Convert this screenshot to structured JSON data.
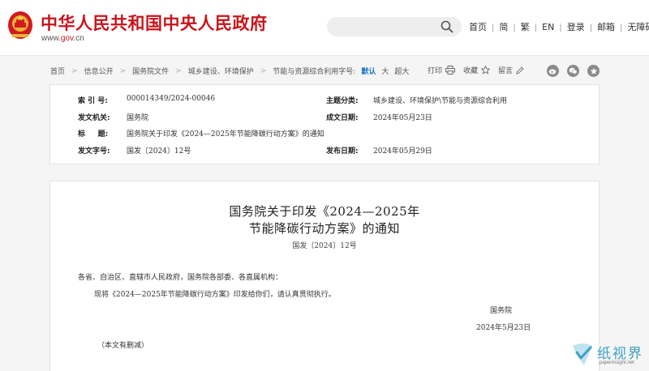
{
  "header": {
    "site_title": "中华人民共和国中央人民政府",
    "url_prefix": "www.",
    "url_brand": "gov",
    "url_suffix": ".cn",
    "search": {
      "value": "",
      "placeholder": ""
    },
    "nav": [
      "首页",
      "简",
      "繁",
      "EN",
      "登录",
      "邮箱",
      "无障碍"
    ]
  },
  "breadcrumb": {
    "items": [
      "首页",
      "信息公开",
      "国务院文件",
      "城乡建设、环境保护",
      "节能与资源综合利用"
    ],
    "font_size_label": "字号:",
    "font_sizes": [
      "默认",
      "大",
      "超大"
    ],
    "active_font_size": "默认"
  },
  "tools": {
    "print": "打印",
    "favorite": "收藏",
    "comment": "留言"
  },
  "share_icons": [
    "weibo-icon",
    "wechat-icon",
    "more-share-icon"
  ],
  "meta": {
    "index_label": "索 引 号:",
    "index_value": "000014349/2024-00046",
    "category_label": "主题分类:",
    "category_value": "城乡建设、环境保护\\节能与资源综合利用",
    "issuer_label": "发文机关:",
    "issuer_value": "国务院",
    "created_label": "成文日期:",
    "created_value": "2024年05月23日",
    "title_label": "标     题:",
    "title_value": "国务院关于印发《2024—2025年节能降碳行动方案》的通知",
    "docno_label": "发文字号:",
    "docno_value": "国发〔2024〕12号",
    "published_label": "发布日期:",
    "published_value": "2024年05月29日"
  },
  "article": {
    "title_line1": "国务院关于印发《2024—2025年",
    "title_line2": "节能降碳行动方案》的通知",
    "doc_number": "国发〔2024〕12号",
    "salutation": "各省、自治区、直辖市人民政府，国务院各部委、各直属机构：",
    "body": "现将《2024—2025年节能降碳行动方案》印发给你们，请认真贯彻执行。",
    "signatory": "国务院",
    "date": "2024年5月23日",
    "note": "（本文有删减）"
  },
  "watermark": {
    "text": "纸视界",
    "sub": "paperinsight.net"
  },
  "colors": {
    "brand_red": "#c8141b",
    "active_blue": "#1a73c4",
    "watermark_blue": "#3fa0c8"
  }
}
